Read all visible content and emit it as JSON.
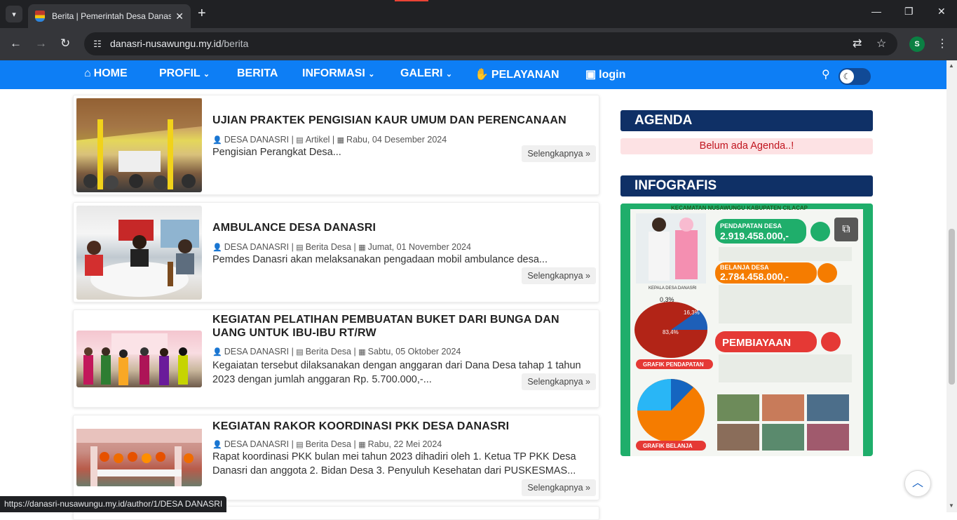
{
  "browser": {
    "tab_title": "Berita | Pemerintah Desa Danas",
    "url_host": "danasri-nusawungu.my.id",
    "url_path": "/berita",
    "profile_initial": "S",
    "status_url": "https://danasri-nusawungu.my.id/author/1/DESA DANASRI"
  },
  "nav": {
    "home": "HOME",
    "profil": "PROFIL",
    "berita": "BERITA",
    "informasi": "INFORMASI",
    "galeri": "GALERI",
    "pelayanan": "PELAYANAN",
    "login": "login"
  },
  "articles": [
    {
      "title": "UJIAN PRAKTEK PENGISIAN KAUR UMUM DAN PERENCANAAN",
      "author": "DESA DANASRI",
      "category": "Artikel",
      "date": "Rabu, 04 Desember 2024",
      "excerpt": "Pengisian Perangkat Desa...",
      "readmore": "Selengkapnya »"
    },
    {
      "title": "AMBULANCE DESA DANASRI",
      "author": "DESA DANASRI",
      "category": "Berita Desa",
      "date": "Jumat, 01 November 2024",
      "excerpt": "Pemdes Danasri akan melaksanakan pengadaan mobil ambulance desa...",
      "readmore": "Selengkapnya »"
    },
    {
      "title": "KEGIATAN PELATIHAN PEMBUATAN BUKET DARI BUNGA DAN UANG UNTUK IBU-IBU RT/RW",
      "author": "DESA DANASRI",
      "category": "Berita Desa",
      "date": "Sabtu, 05 Oktober 2024",
      "excerpt": "Kegaiatan tersebut dilaksanakan dengan anggaran dari Dana Desa tahap 1 tahun 2023 dengan jumlah anggaran Rp. 5.700.000,-...",
      "readmore": "Selengkapnya »"
    },
    {
      "title": "KEGIATAN RAKOR KOORDINASI PKK DESA DANASRI",
      "author": "DESA DANASRI",
      "category": "Berita Desa",
      "date": "Rabu, 22 Mei 2024",
      "excerpt": "Rapat koordinasi PKK bulan mei tahun 2023 dihadiri oleh 1. Ketua TP PKK Desa Danasri dan anggota 2. Bidan Desa 3. Penyuluh Kesehatan dari PUSKESMAS...",
      "readmore": "Selengkapnya »"
    }
  ],
  "sidebar": {
    "agenda_title": "AGENDA",
    "agenda_empty": "Belum ada Agenda..!",
    "infografis_title": "INFOGRAFIS",
    "infografis": {
      "header": "KECAMATAN NUSAWUNGU KABUPATEN CILACAP",
      "pendapatan_label": "PENDAPATAN DESA",
      "pendapatan_value": "2.919.458.000,-",
      "belanja_label": "BELANJA DESA",
      "belanja_value": "2.784.458.000,-",
      "pembiayaan_label": "PEMBIAYAAN",
      "kepala_label": "KEPALA DESA DANASRI",
      "grafik_pendapatan": "GRAFIK PENDAPATAN",
      "grafik_belanja": "GRAFIK BELANJA",
      "pie_pct_1": "0,3%",
      "pie_pct_2": "16,3%",
      "pie_pct_3": "83,4%"
    }
  },
  "colors": {
    "nav_bg": "#0d7ef5",
    "widget_title_bg": "#0f3066",
    "agenda_empty_bg": "#fde2e4",
    "agenda_empty_text": "#c0141e"
  }
}
